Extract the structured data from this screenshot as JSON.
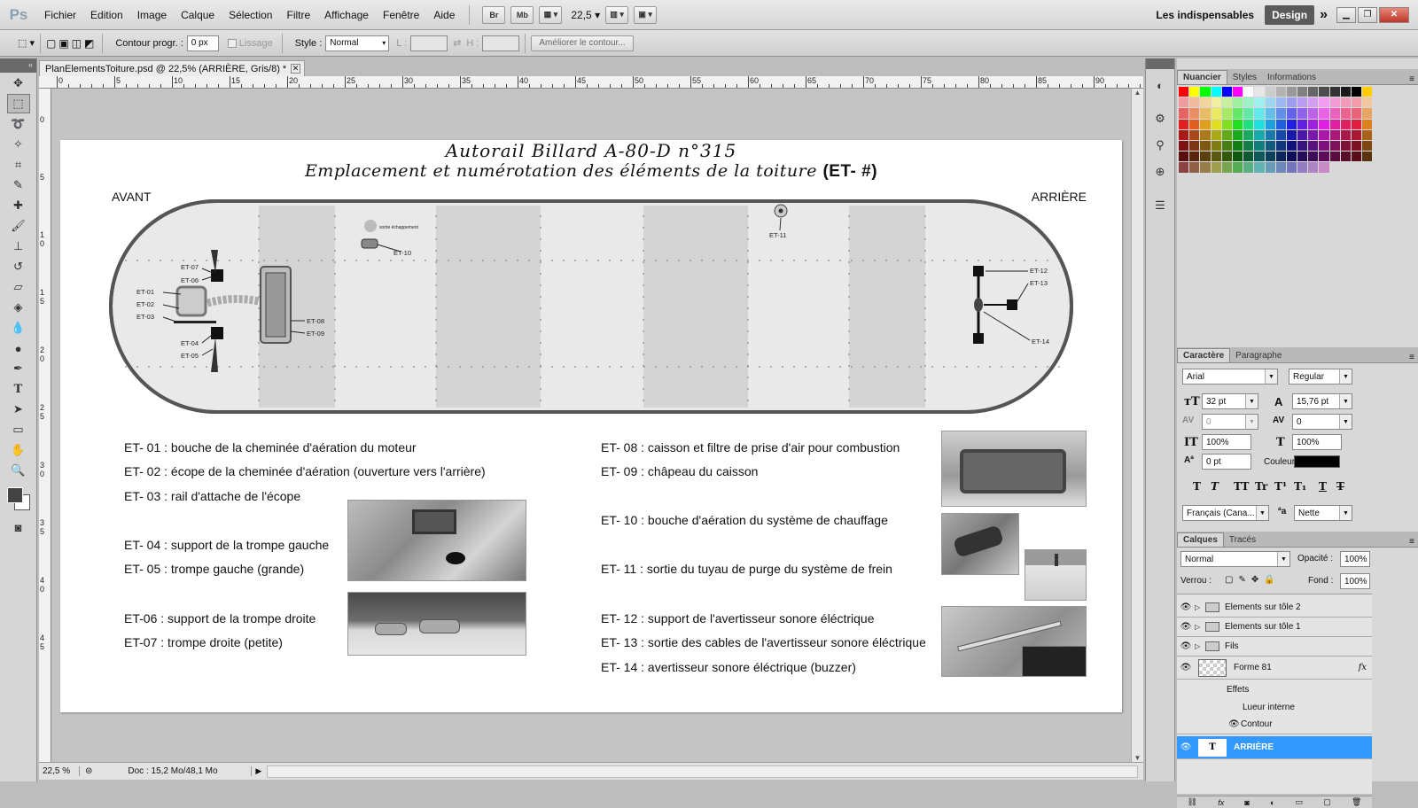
{
  "app": {
    "logo": "Ps"
  },
  "menu": {
    "items": [
      "Fichier",
      "Edition",
      "Image",
      "Calque",
      "Sélection",
      "Filtre",
      "Affichage",
      "Fenêtre",
      "Aide"
    ]
  },
  "menubar": {
    "br": "Br",
    "mb": "Mb",
    "zoom": "22,5",
    "workspace": "Les indispensables",
    "design": "Design"
  },
  "options": {
    "feather_label": "Contour progr. :",
    "feather_value": "0 px",
    "antialias_label": "Lissage",
    "style_label": "Style :",
    "style_value": "Normal",
    "width_label": "L :",
    "height_label": "H :",
    "refine_button": "Améliorer le contour..."
  },
  "document": {
    "tab_title": "PlanElementsToiture.psd @ 22,5% (ARRIÈRE, Gris/8) *",
    "ruler_top": [
      "0",
      "5",
      "10",
      "15",
      "20",
      "25",
      "30",
      "35",
      "40",
      "45",
      "50",
      "55",
      "60",
      "65",
      "70",
      "75",
      "80",
      "85",
      "90"
    ],
    "ruler_left": [
      "0",
      "5",
      "1 0",
      "1 5",
      "2 0",
      "2 5",
      "3 0",
      "3 5",
      "4 0",
      "4 5"
    ],
    "status_zoom": "22,5 %",
    "status_doc": "Doc : 15,2 Mo/48,1 Mo"
  },
  "page": {
    "title_line1": "Autorail Billard A-80-D n°315",
    "title_line2": "Emplacement et numérotation des éléments de la toiture ",
    "title_code": "(ET- #)",
    "avant": "AVANT",
    "arriere": "ARRIÈRE",
    "plan_labels": {
      "et01": "ET-01",
      "et02": "ET-02",
      "et03": "ET-03",
      "et04": "ET-04",
      "et05": "ET-05",
      "et06": "ET-06",
      "et07": "ET-07",
      "et08": "ET-08",
      "et09": "ET-09",
      "et10": "ET-10",
      "et11": "ET-11",
      "et12": "ET-12",
      "et13": "ET-13",
      "et14": "ET-14",
      "sortie": "sortie échappement"
    },
    "legend_left": [
      "ET- 01 : bouche de la cheminée d'aération du moteur",
      "ET- 02 : écope de la cheminée d'aération (ouverture vers l'arrière)",
      "ET- 03 : rail d'attache de l'écope",
      "ET- 04 : support de la trompe gauche",
      "ET- 05 : trompe gauche (grande)",
      "ET-06 : support de la trompe droite",
      "ET-07 : trompe droite (petite)"
    ],
    "legend_right": [
      "ET- 08 : caisson et filtre de prise d'air pour combustion",
      "ET- 09 : châpeau du caisson",
      "ET- 10 : bouche d'aération du système de chauffage",
      "ET- 11 : sortie du tuyau de purge du système de frein",
      "ET- 12 : support de l'avertisseur sonore éléctrique",
      "ET- 13 : sortie des cables de l'avertisseur sonore éléctrique",
      "ET- 14 : avertisseur sonore éléctrique (buzzer)"
    ]
  },
  "panels": {
    "swatch_tabs": [
      "Nuancier",
      "Styles",
      "Informations"
    ],
    "char_tabs": [
      "Caractère",
      "Paragraphe"
    ],
    "font_family": "Arial",
    "font_style": "Regular",
    "font_size": "32 pt",
    "leading": "15,76 pt",
    "kerning": "0",
    "tracking": "0",
    "vscale": "100%",
    "hscale": "100%",
    "baseline": "0 pt",
    "color_label": "Couleur :",
    "language": "Français (Cana...",
    "antialias": "Nette",
    "layer_tabs": [
      "Calques",
      "Tracés"
    ],
    "blend_mode": "Normal",
    "opacity_label": "Opacité :",
    "opacity": "100%",
    "lock_label": "Verrou :",
    "fill_label": "Fond :",
    "fill": "100%",
    "layers": [
      "Elements sur tôle 2",
      "Elements sur tôle 1",
      "Fils",
      "Forme 81",
      "Effets",
      "Lueur interne",
      "Contour",
      "ARRIÈRE"
    ],
    "fx": "fx"
  },
  "colors": {
    "accent": "#3399ff",
    "menubar": "#dcdcdc",
    "canvas_bg": "#c4c4c4"
  }
}
